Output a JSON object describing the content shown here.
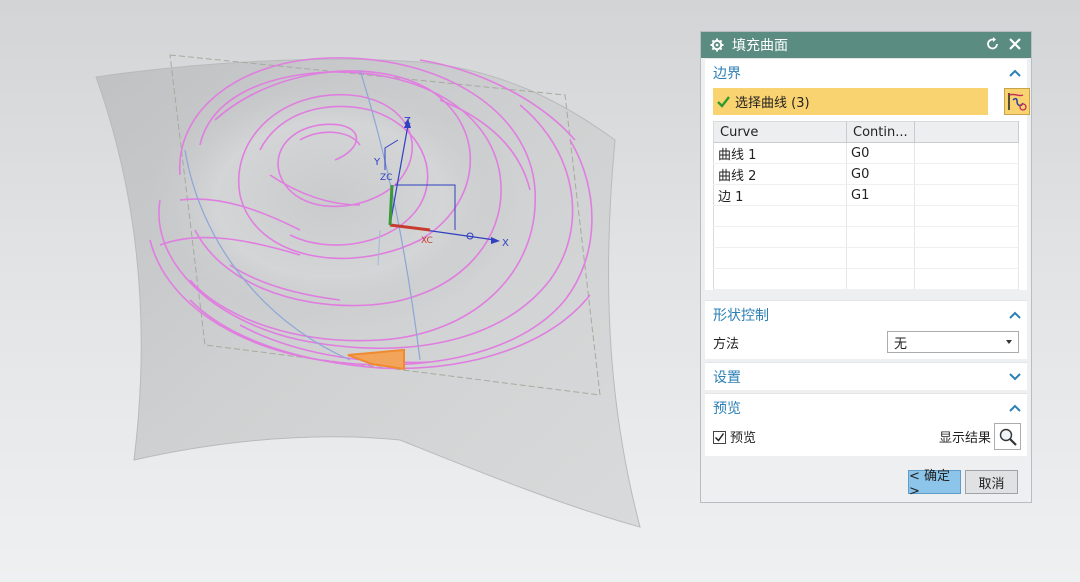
{
  "dialog": {
    "title": "填充曲面",
    "boundary": {
      "header": "边界",
      "select_label": "选择曲线 (3)",
      "columns": [
        "Curve",
        "Contin..."
      ],
      "rows": [
        [
          "曲线 1",
          "G0"
        ],
        [
          "曲线 2",
          "G0"
        ],
        [
          "边 1",
          "G1"
        ]
      ]
    },
    "shape": {
      "header": "形状控制",
      "method_label": "方法",
      "method_value": "无"
    },
    "settings": {
      "header": "设置"
    },
    "preview": {
      "header": "预览",
      "checkbox_label": "预览",
      "checked": true,
      "show_result_label": "显示结果"
    },
    "ok_label": "< 确定 >",
    "cancel_label": "取消"
  },
  "viewport": {
    "axes": {
      "z": "Z",
      "x": "X",
      "xc": "XC",
      "zc": "ZC",
      "y": "Y"
    }
  },
  "colors": {
    "titlebar": "#5a8c82",
    "section_header": "#2b7fb5",
    "selection_highlight": "#fad371",
    "curve_magenta": "#e07ee0",
    "ok_button": "#8cc4ea"
  }
}
